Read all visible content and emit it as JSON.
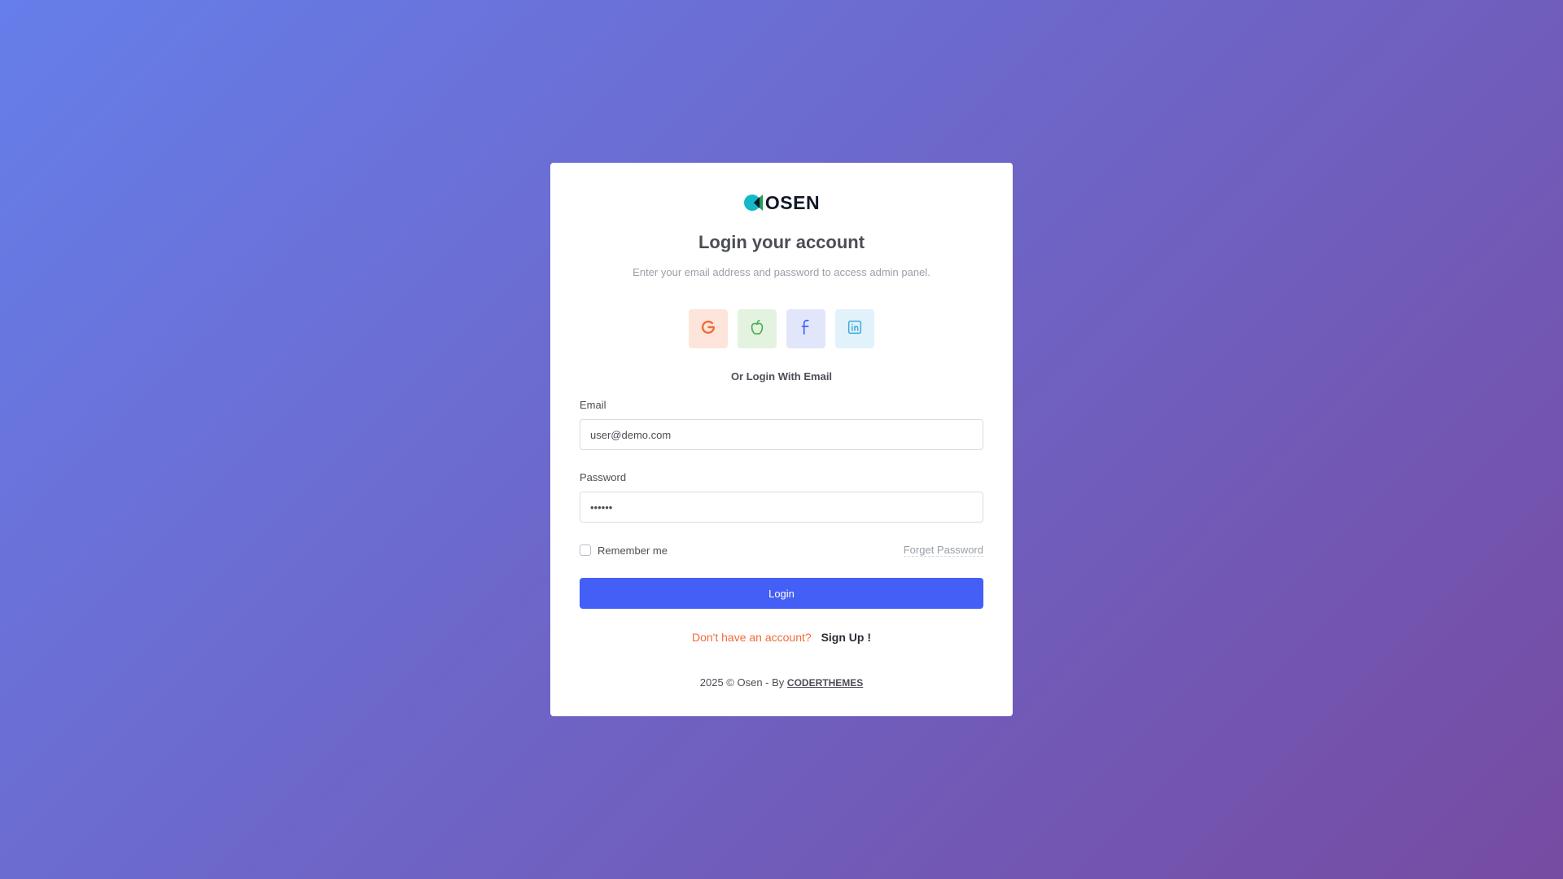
{
  "brand": {
    "logo_text": "OSEN"
  },
  "header": {
    "title": "Login your account",
    "subtitle": "Enter your email address and password to access admin panel."
  },
  "social": [
    {
      "name": "google-icon",
      "bg": "#fde5dc",
      "color": "#f26b3a"
    },
    {
      "name": "apple-icon",
      "bg": "#e3f3e0",
      "color": "#4caf50"
    },
    {
      "name": "facebook-icon",
      "bg": "#e2e6fb",
      "color": "#435ff6"
    },
    {
      "name": "linkedin-icon",
      "bg": "#e2f2fb",
      "color": "#3aa7dc"
    }
  ],
  "divider_text": "Or Login With Email",
  "form": {
    "email_label": "Email",
    "email_value": "user@demo.com",
    "password_label": "Password",
    "password_value": "••••••",
    "remember_label": "Remember me",
    "forget_label": "Forget Password",
    "login_label": "Login"
  },
  "signup": {
    "prompt": "Don't have an account?",
    "link": "Sign Up !"
  },
  "footer": {
    "text": "2025 © Osen - By",
    "link": "CODERTHEMES"
  },
  "colors": {
    "primary": "#435ff6",
    "accent": "#f26b3a",
    "gradient_start": "#667eea",
    "gradient_end": "#764ba2"
  }
}
